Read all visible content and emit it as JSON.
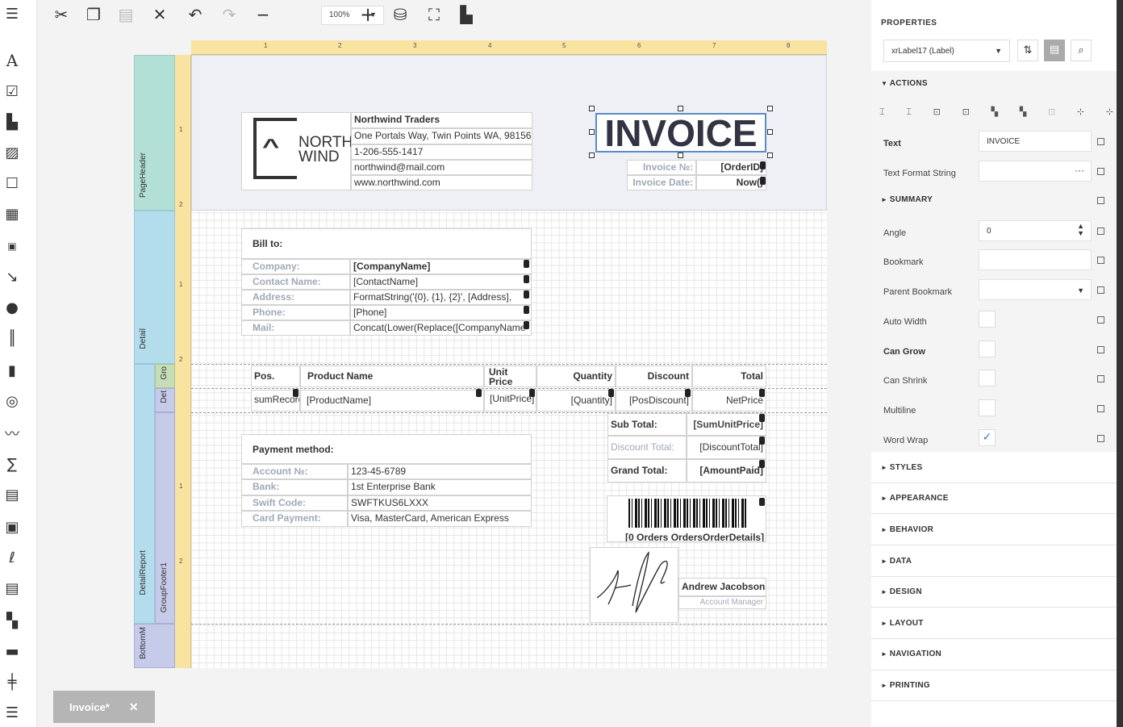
{
  "toolbar": {
    "zoom": "100%"
  },
  "ruler": {
    "top_numbers": [
      "1",
      "2",
      "3",
      "4",
      "5",
      "6",
      "7",
      "8"
    ],
    "left_header": [
      "1",
      "2"
    ],
    "left_detail": [
      "1",
      "2"
    ],
    "left_footer": [
      "1",
      "2"
    ]
  },
  "bands": {
    "page_header": "PageHeader",
    "detail": "Detail",
    "group_header": "Gro",
    "detail_sub": "Det",
    "detail_report": "DetailReport",
    "group_footer": "GroupFooter1",
    "bottom_margin": "BottomM"
  },
  "company": {
    "logo_line1": "NORTH",
    "logo_line2": "WIND",
    "name": "Northwind Traders",
    "address": "One Portals Way, Twin Points WA, 98156",
    "phone": "1-206-555-1417",
    "email": "northwind@mail.com",
    "web": "www.northwind.com"
  },
  "invoice": {
    "title": "INVOICE",
    "no_label": "Invoice №:",
    "no_value": "[OrderID]",
    "date_label": "Invoice Date:",
    "date_value": "Now()"
  },
  "bill_to": {
    "heading": "Bill to:",
    "rows": [
      {
        "label": "Company:",
        "value": "[CompanyName]",
        "bold": true
      },
      {
        "label": "Contact Name:",
        "value": "[ContactName]"
      },
      {
        "label": "Address:",
        "value": "FormatString('{0}, {1}, {2}', [Address],"
      },
      {
        "label": "Phone:",
        "value": "[Phone]"
      },
      {
        "label": "Mail:",
        "value": "Concat(Lower(Replace([CompanyName"
      }
    ]
  },
  "table_headers": [
    "Pos.",
    "Product Name",
    "Unit Price",
    "Quantity",
    "Discount",
    "Total"
  ],
  "table_row": [
    "sumRecordNumber",
    "[ProductName]",
    "[UnitPrice]",
    "[Quantity]",
    "[PosDiscount]",
    "NetPrice"
  ],
  "payment": {
    "heading": "Payment method:",
    "rows": [
      {
        "label": "Account №:",
        "value": "123-45-6789"
      },
      {
        "label": "Bank:",
        "value": "1st Enterprise Bank"
      },
      {
        "label": "Swift Code:",
        "value": "SWFTKUS6LXXX"
      },
      {
        "label": "Card Payment:",
        "value": "Visa, MasterCard, American Express"
      }
    ]
  },
  "totals": {
    "sub_label": "Sub Total:",
    "sub_value": "[SumUnitPrice]",
    "discount_label": "Discount Total:",
    "discount_value": "[DiscountTotal]",
    "grand_label": "Grand Total:",
    "grand_value": "[AmountPaid]"
  },
  "barcode_text": "[0 Orders OrdersOrderDetails]",
  "signature": {
    "name": "Andrew Jacobson",
    "title": "Account Manager"
  },
  "doc_tab": {
    "label": "Invoice*",
    "close": "✕"
  },
  "properties": {
    "title": "PROPERTIES",
    "selected": "xrLabel17 (Label)",
    "sections": {
      "actions": "ACTIONS",
      "summary": "SUMMARY",
      "styles": "STYLES",
      "appearance": "APPEARANCE",
      "behavior": "BEHAVIOR",
      "data": "DATA",
      "design": "DESIGN",
      "layout": "LAYOUT",
      "navigation": "NAVIGATION",
      "printing": "PRINTING"
    },
    "rows": {
      "text_label": "Text",
      "text_value": "INVOICE",
      "format_label": "Text Format String",
      "format_btn": "···",
      "angle_label": "Angle",
      "angle_value": "0",
      "bookmark_label": "Bookmark",
      "parent_bookmark_label": "Parent Bookmark",
      "auto_width_label": "Auto Width",
      "can_grow_label": "Can Grow",
      "can_shrink_label": "Can Shrink",
      "multiline_label": "Multiline",
      "word_wrap_label": "Word Wrap"
    },
    "checks": {
      "auto_width": false,
      "can_grow": false,
      "can_shrink": false,
      "multiline": false,
      "word_wrap": true
    }
  }
}
